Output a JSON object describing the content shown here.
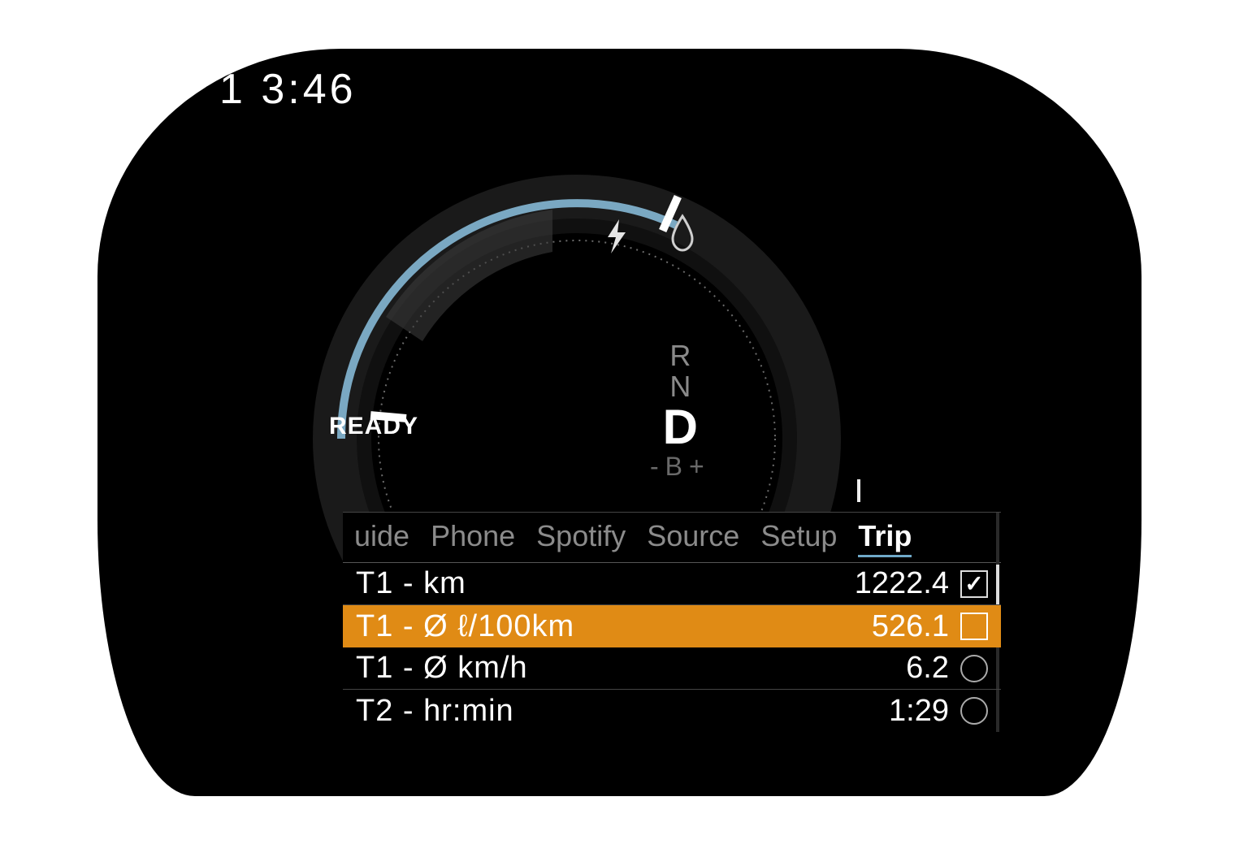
{
  "clock": "1 3:46",
  "ready_label": "READY",
  "gears": {
    "r": "R",
    "n": "N",
    "d": "D",
    "b": "B",
    "b_minus": "-",
    "b_plus": "+"
  },
  "icons": {
    "power": "lightning-icon",
    "fuel": "drop-icon"
  },
  "tabs": [
    {
      "id": "guide",
      "label": "uide"
    },
    {
      "id": "phone",
      "label": "Phone"
    },
    {
      "id": "spotify",
      "label": "Spotify"
    },
    {
      "id": "source",
      "label": "Source"
    },
    {
      "id": "setup",
      "label": "Setup"
    },
    {
      "id": "trip",
      "label": "Trip",
      "active": true
    }
  ],
  "trip_rows": [
    {
      "label": "T1 - km",
      "value": "1222.4",
      "marker": "box-checked",
      "selected": false
    },
    {
      "label": "T1 - Ø ℓ/100km",
      "value": "526.1",
      "marker": "box",
      "selected": true
    },
    {
      "label": "T1 - Ø km/h",
      "value": "6.2",
      "marker": "radio",
      "selected": false
    },
    {
      "label": "T2 - hr:min",
      "value": "1:29",
      "marker": "radio",
      "selected": false
    }
  ],
  "colors": {
    "highlight": "#e08b15",
    "accent_arc": "#7aa8c2"
  }
}
